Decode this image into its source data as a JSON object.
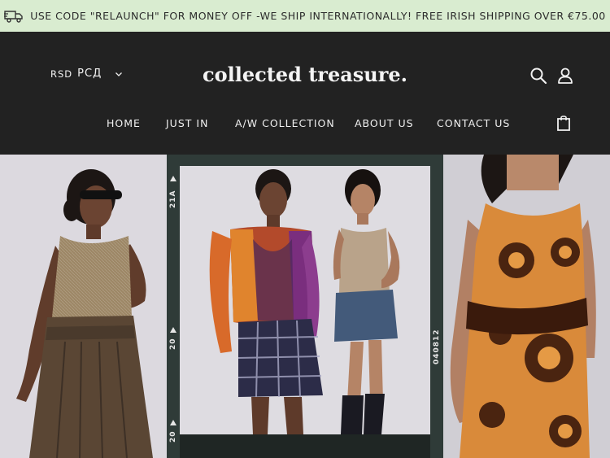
{
  "announcement": {
    "text": "USE CODE \"RELAUNCH\" FOR MONEY OFF -WE SHIP INTERNATIONALLY! FREE IRISH SHIPPING OVER €75.00",
    "icon": "truck-icon"
  },
  "header": {
    "currency": {
      "code": "RSD",
      "symbol": "РСД"
    },
    "logo": "collected treasure.",
    "icons": [
      "search-icon",
      "account-icon",
      "cart-icon"
    ]
  },
  "nav": {
    "items": [
      {
        "label": "HOME"
      },
      {
        "label": "JUST IN"
      },
      {
        "label": "A/W COLLECTION"
      },
      {
        "label": "ABOUT US"
      },
      {
        "label": "CONTACT US"
      }
    ]
  },
  "hero": {
    "film_labels": [
      "21A",
      "20",
      "20",
      "040812"
    ]
  },
  "colors": {
    "announcement_bg": "#d9ecd0",
    "header_bg": "#222222",
    "film_strip": "#2f3b38"
  }
}
